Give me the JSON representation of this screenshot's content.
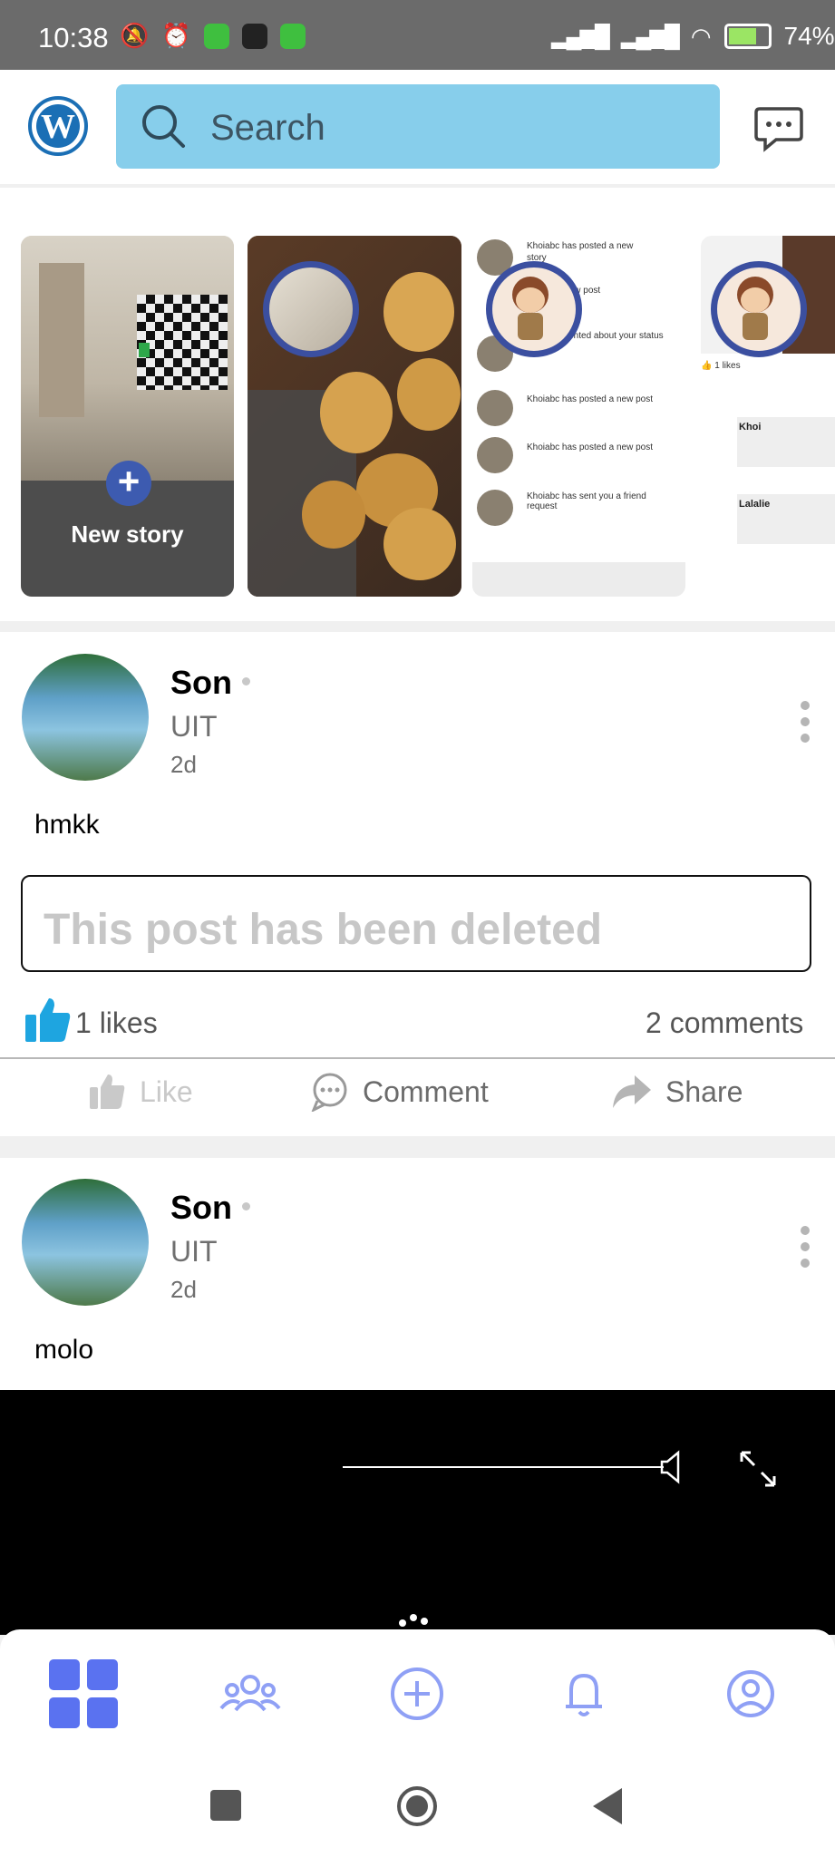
{
  "status_bar": {
    "time": "10:38",
    "battery": "74%"
  },
  "search": {
    "placeholder": "Search"
  },
  "stories": {
    "new_story_label": "New story"
  },
  "posts": [
    {
      "author": "Son",
      "group": "UIT",
      "time": "2d",
      "text": "hmkk",
      "shared_notice": "This post has been deleted",
      "likes": "1 likes",
      "comments": "2 comments",
      "actions": {
        "like": "Like",
        "comment": "Comment",
        "share": "Share"
      }
    },
    {
      "author": "Son",
      "group": "UIT",
      "time": "2d",
      "text": "molo"
    }
  ],
  "bottom_nav": [
    "home-grid-icon",
    "groups-icon",
    "add-post-icon",
    "notifications-bell-icon",
    "profile-icon"
  ],
  "colors": {
    "accent": "#5a72f0",
    "search_bg": "#87ceeb",
    "like_blue": "#1ea5e0"
  }
}
